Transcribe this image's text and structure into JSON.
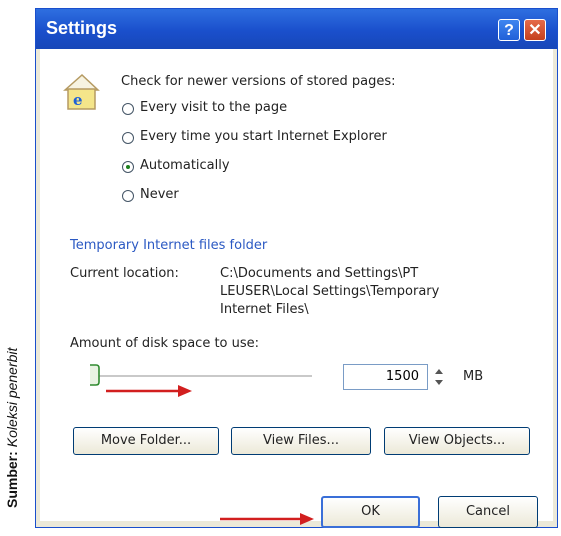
{
  "window": {
    "title": "Settings",
    "help_glyph": "?",
    "close_glyph": "✕"
  },
  "check": {
    "heading": "Check for newer versions of stored pages:",
    "options": [
      {
        "label": "Every visit to the page",
        "selected": false
      },
      {
        "label": "Every time you start Internet Explorer",
        "selected": false
      },
      {
        "label": "Automatically",
        "selected": true
      },
      {
        "label": "Never",
        "selected": false
      }
    ]
  },
  "temp_folder": {
    "heading": "Temporary Internet files folder",
    "location_label": "Current location:",
    "location_lines": [
      "C:\\Documents and Settings\\PT",
      "LEUSER\\Local Settings\\Temporary",
      "Internet Files\\"
    ]
  },
  "disk": {
    "label": "Amount of disk space to use:",
    "value": "1500",
    "unit": "MB"
  },
  "buttons": {
    "move_folder": "Move Folder...",
    "view_files": "View Files...",
    "view_objects": "View Objects...",
    "ok": "OK",
    "cancel": "Cancel"
  },
  "caption": {
    "lead": "Sumber:",
    "rest": "Koleksi penerbit"
  },
  "icons": [
    "ie-page-icon",
    "slider-handle-icon",
    "spin-up-icon",
    "spin-down-icon",
    "red-arrow-icon"
  ],
  "colors": {
    "titlebar": "#1a4fcc",
    "section_title": "#2b59c3",
    "arrow": "#d21f1f"
  }
}
